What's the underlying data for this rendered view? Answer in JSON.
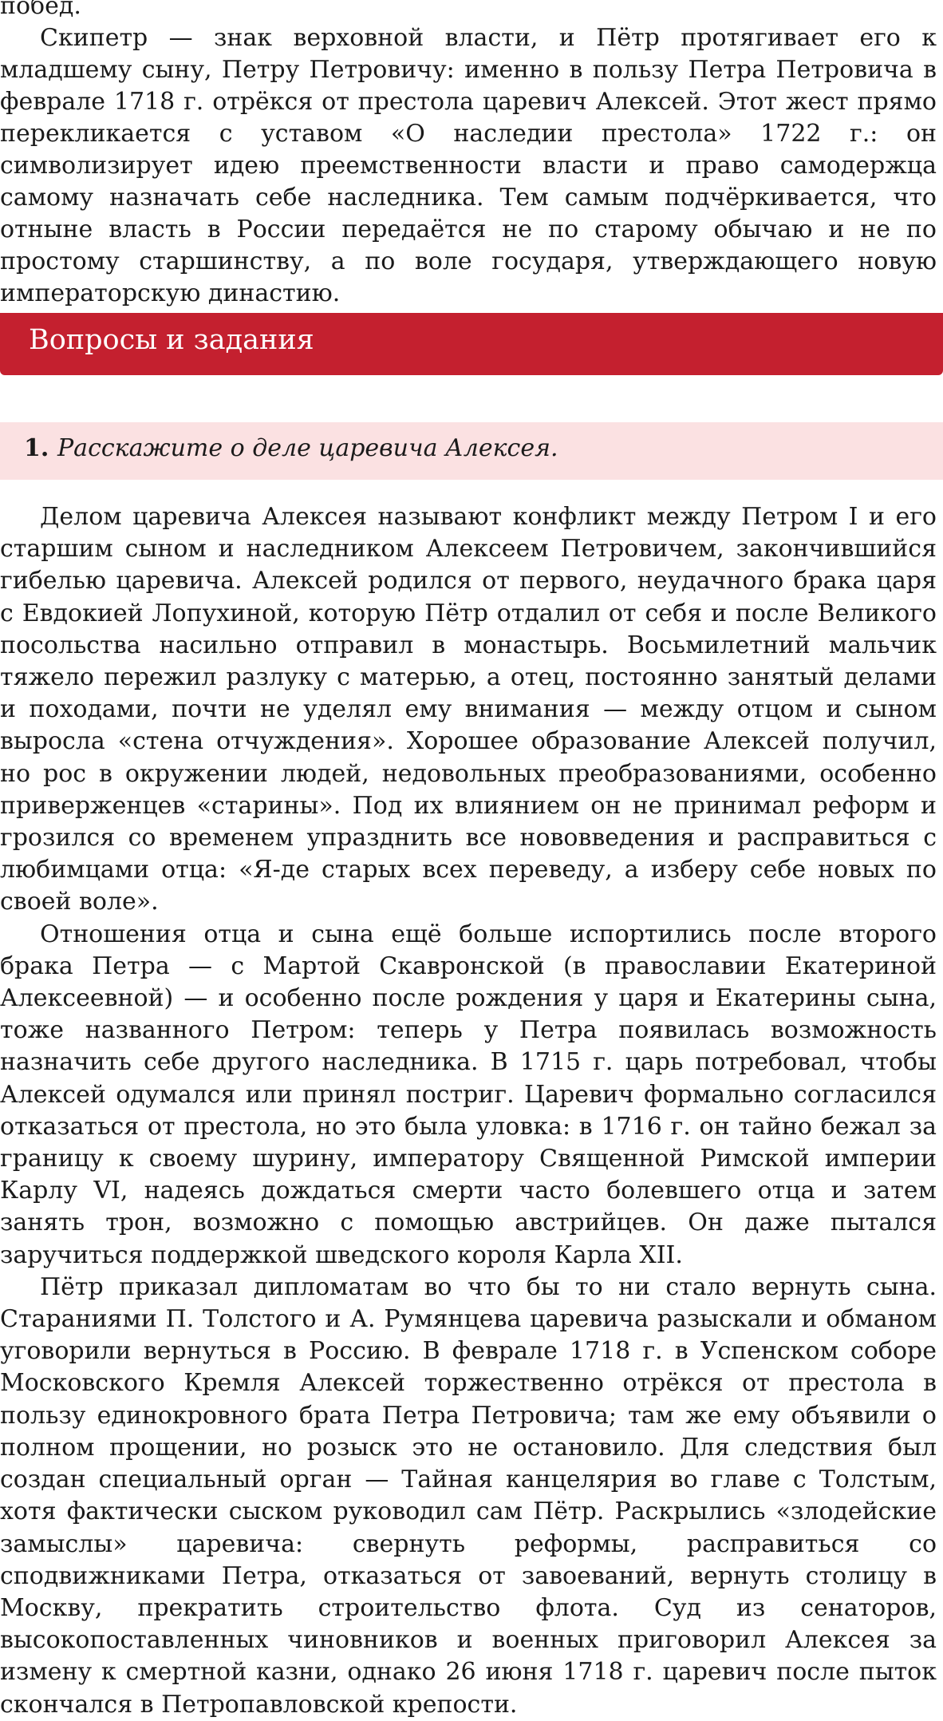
{
  "top": {
    "line_prev": "побед.",
    "paragraph": "Скипетр — знак верховной власти, и Пётр протягивает его к младшему сыну, Петру Петровичу: именно в пользу Петра Петровича в феврале 1718 г. отрёкся от престола царевич Алексей. Этот жест прямо перекликается с уставом «О наследии престола» 1722 г.: он символизирует идею преемственности власти и право самодержца самому назначать себе наследника. Тем самым подчёркивается, что отныне власть в России передаётся не по старому обычаю и не по простому старшинству, а по воле государя, утверждающего новую императорскую династию."
  },
  "section": {
    "title": "Вопросы и задания"
  },
  "question": {
    "number": "1.",
    "text": "Расскажите о деле царевича Алексея."
  },
  "answer": {
    "paragraphs": [
      "Делом царевича Алексея называют конфликт между Петром I и его старшим сыном и наследником Алексеем Петровичем, закончившийся гибелью царевича. Алексей родился от первого, неудачного брака царя с Евдокией Лопухиной, которую Пётр отдалил от себя и после Великого посольства насильно отправил в монастырь. Восьмилетний мальчик тяжело пережил разлуку с матерью, а отец, постоянно занятый делами и походами, почти не уделял ему внимания — между отцом и сыном выросла «стена отчуждения». Хорошее образование Алексей получил, но рос в окружении людей, недовольных преобразованиями, особенно приверженцев «старины». Под их влиянием он не принимал реформ и грозился со временем упразднить все нововведения и расправиться с любимцами отца: «Я-де старых всех переведу, а изберу себе новых по своей воле».",
      "Отношения отца и сына ещё больше испортились после второго брака Петра — с Мартой Скавронской (в православии Екатериной Алексеевной) — и особенно после рождения у царя и Екатерины сына, тоже названного Петром: теперь у Петра появилась возможность назначить себе другого наследника. В 1715 г. царь потребовал, чтобы Алексей одумался или принял постриг. Царевич формально согласился отказаться от престола, но это была уловка: в 1716 г. он тайно бежал за границу к своему шурину, императору Священной Римской империи Карлу VI, надеясь дождаться смерти часто болевшего отца и затем занять трон, возможно с помощью австрийцев. Он даже пытался заручиться поддержкой шведского короля Карла XII.",
      "Пётр приказал дипломатам во что бы то ни стало вернуть сына. Стараниями П. Толстого и А. Румянцева царевича разыскали и обманом уговорили вернуться в Россию. В феврале 1718 г. в Успенском соборе Московского Кремля Алексей торжественно отрёкся от престола в пользу единокровного брата Петра Петровича; там же ему объявили о полном прощении, но розыск это не остановило. Для следствия был создан специальный орган — Тайная канцелярия во главе с Толстым, хотя фактически сыском руководил сам Пётр. Раскрылись «злодейские замыслы» царевича: свернуть реформы, расправиться со сподвижниками Петра, отказаться от завоеваний, вернуть столицу в Москву, прекратить строительство флота. Суд из сенаторов, высокопоставленных чиновников и военных приговорил Алексея за измену к смертной казни, однако 26 июня 1718 г. царевич после пыток скончался в Петропавловской крепости."
    ]
  },
  "colors": {
    "header_red": "#c4202f",
    "question_bg": "#fbe1e2",
    "text": "#1a1a1a"
  }
}
